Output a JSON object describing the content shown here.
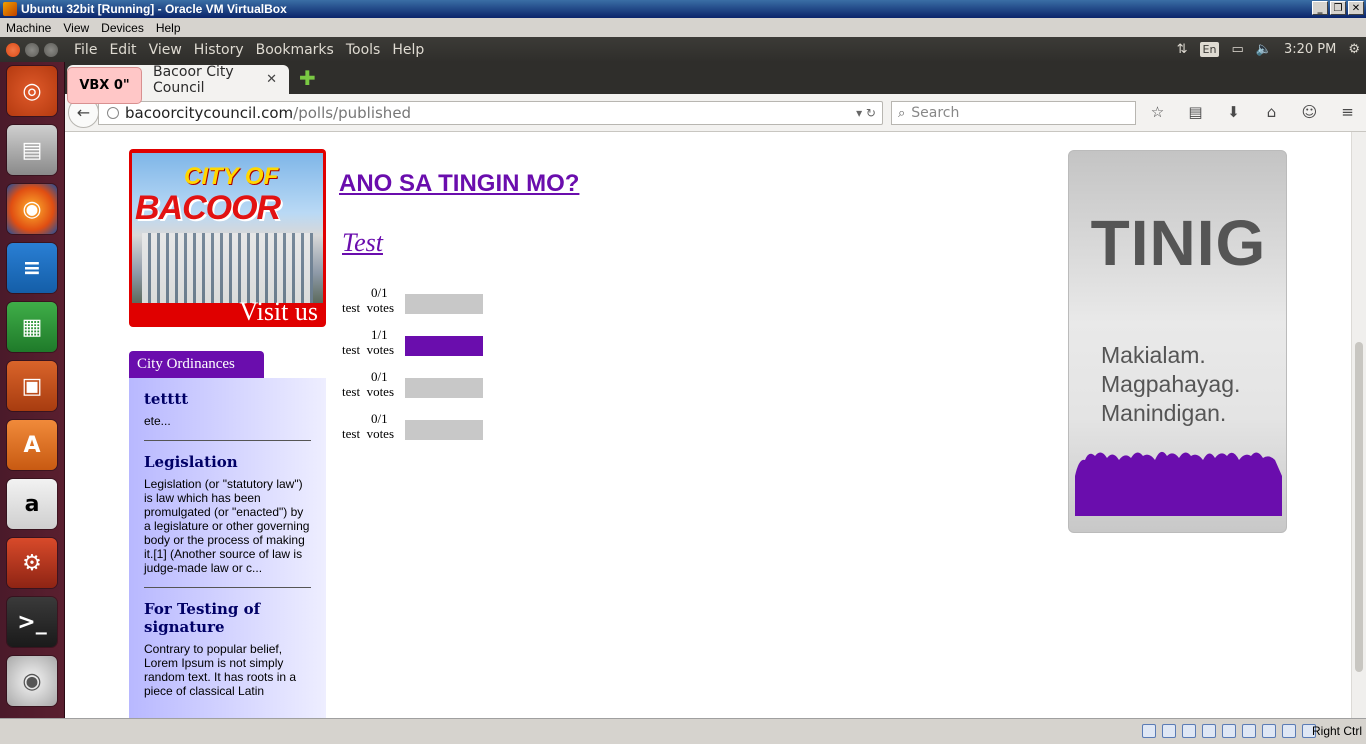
{
  "vbox": {
    "title": "Ubuntu 32bit [Running] - Oracle VM VirtualBox",
    "menu": [
      "Machine",
      "View",
      "Devices",
      "Help"
    ],
    "status_host_key": "Right Ctrl"
  },
  "unity": {
    "ff_menu": [
      "File",
      "Edit",
      "View",
      "History",
      "Bookmarks",
      "Tools",
      "Help"
    ],
    "keyboard_layout": "En",
    "clock": "3:20 PM"
  },
  "launcher_icons": [
    "ubuntu-dash-icon",
    "files-icon",
    "firefox-icon",
    "writer-icon",
    "calc-icon",
    "impress-icon",
    "software-center-icon",
    "amazon-icon",
    "system-settings-icon",
    "terminal-icon",
    "dvd-icon"
  ],
  "browser": {
    "tab_title": "Bacoor City Council",
    "vbx_overlay": "VBX 0\"",
    "url_host": "bacoorcitycouncil.com",
    "url_path": "/polls/published",
    "search_placeholder": "Search"
  },
  "page": {
    "banner": {
      "title_line1": "CITY OF",
      "title_line2": "BACOOR",
      "visit": "Visit us"
    },
    "ordinances": {
      "tab_label": "City Ordinances",
      "items": [
        {
          "title": "tetttt",
          "text": "ete..."
        },
        {
          "title": "Legislation",
          "text": "Legislation (or \"statutory law\") is law which has been promulgated (or \"enacted\") by a legislature or other governing body or the process of making it.[1] (Another source of law is judge-made law or c..."
        },
        {
          "title": "For Testing of signature",
          "text": "Contrary to popular belief, Lorem Ipsum is not simply random text. It has roots in a piece of classical Latin"
        }
      ]
    },
    "poll": {
      "heading": "ANO SA TINGIN MO?",
      "question": "Test",
      "options": [
        {
          "label": "test",
          "votes_label": "votes",
          "count": "0/1",
          "fraction": 0
        },
        {
          "label": "test",
          "votes_label": "votes",
          "count": "1/1",
          "fraction": 1
        },
        {
          "label": "test",
          "votes_label": "votes",
          "count": "0/1",
          "fraction": 0
        },
        {
          "label": "test",
          "votes_label": "votes",
          "count": "0/1",
          "fraction": 0
        }
      ],
      "accent_color": "#6a0dad"
    },
    "tinig": {
      "title": "TINIG",
      "lines": [
        "Makialam.",
        "Magpahayag.",
        "Manindigan."
      ]
    }
  }
}
